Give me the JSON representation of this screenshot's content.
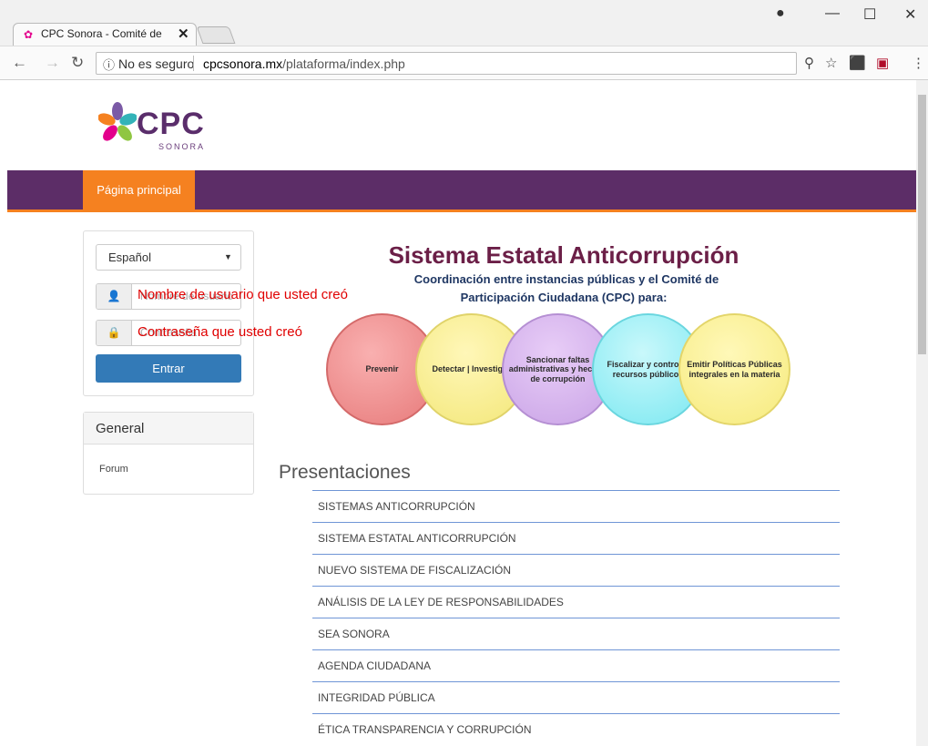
{
  "browser": {
    "tab_title": "CPC Sonora - Comité de",
    "tab_close": "✕",
    "security_label": "No es seguro",
    "url_host": "cpcsonora.mx",
    "url_path": "/plataforma/index.php"
  },
  "logo": {
    "name": "CPC",
    "sub": "SONORA"
  },
  "nav": {
    "home": "Página principal"
  },
  "login": {
    "language": "Español",
    "username_placeholder": "Nombre de usuario",
    "password_placeholder": "Contraseña",
    "username_note": "Nombre de usuario que usted creó",
    "password_note": "Contraseña que usted creó",
    "submit": "Entrar"
  },
  "general": {
    "title": "General",
    "forum": "Forum"
  },
  "banner": {
    "title": "Sistema Estatal Anticorrupción",
    "subtitle_line1": "Coordinación entre instancias públicas y el Comité de",
    "subtitle_line2": "Participación Ciudadana (CPC) para:",
    "circles": [
      "Prevenir",
      "Detectar | Investigar",
      "Sancionar faltas administrativas y hechos de corrupción",
      "Fiscalizar y controlar recursos públicos",
      "Emitir Políticas Públicas integrales en la materia"
    ]
  },
  "presentations": {
    "title": "Presentaciones",
    "items": [
      "SISTEMAS ANTICORRUPCIÓN",
      "SISTEMA ESTATAL ANTICORRUPCIÓN",
      "NUEVO SISTEMA DE FISCALIZACIÓN",
      "ANÁLISIS DE LA LEY DE RESPONSABILIDADES",
      "SEA SONORA",
      "AGENDA CIUDADANA",
      "INTEGRIDAD PÚBLICA",
      "ÉTICA TRANSPARENCIA Y CORRUPCIÓN"
    ]
  }
}
